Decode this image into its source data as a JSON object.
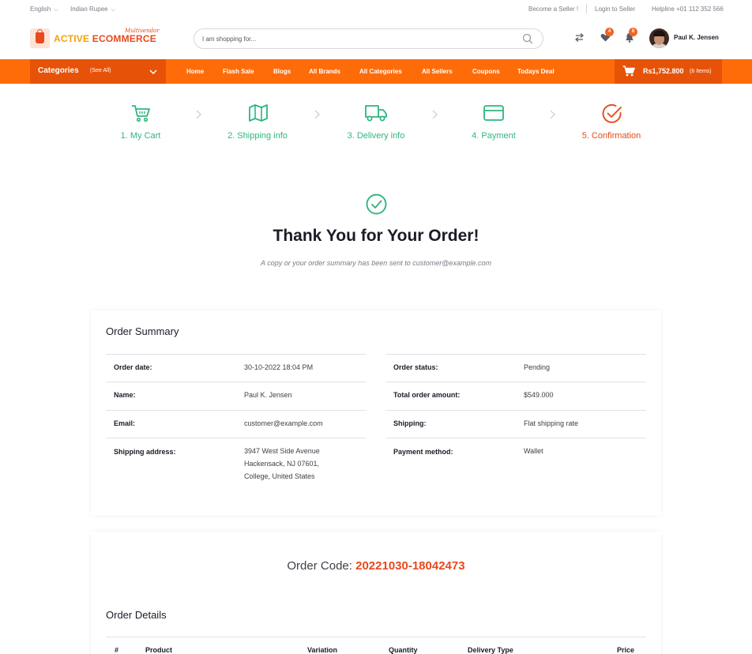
{
  "topbar": {
    "language": "English",
    "currency": "Indian Rupee",
    "become_seller": "Become a Seller !",
    "login_seller": "Login to Seller",
    "helpline": "Helpline +01 112 352 566"
  },
  "header": {
    "logo_word1": "ACTIVE",
    "logo_word2": "ECOMMERCE",
    "logo_tagline": "Multivendor",
    "search_placeholder": "I am shopping for...",
    "wishlist_count": "4",
    "notification_count": "8",
    "user_name": "Paul K. Jensen"
  },
  "nav": {
    "categories_label": "Categories",
    "see_all": "(See All)",
    "links": [
      "Home",
      "Flash Sale",
      "Blogs",
      "All Brands",
      "All Categories",
      "All Sellers",
      "Coupons",
      "Todays Deal"
    ],
    "cart_amount": "Rs1,752.800",
    "cart_items": "(6 Items)"
  },
  "steps": [
    {
      "label": "1. My Cart",
      "icon": "cart-icon"
    },
    {
      "label": "2. Shipping info",
      "icon": "map-icon"
    },
    {
      "label": "3. Delivery info",
      "icon": "truck-icon"
    },
    {
      "label": "4. Payment",
      "icon": "card-icon"
    },
    {
      "label": "5. Confirmation",
      "icon": "check-circle-icon"
    }
  ],
  "thankyou": {
    "title": "Thank You for Your Order!",
    "subtitle": "A copy or your order summary has been sent to customer@example.com"
  },
  "order_summary": {
    "title": "Order Summary",
    "left": [
      {
        "label": "Order date:",
        "value": "30-10-2022 18:04 PM"
      },
      {
        "label": "Name:",
        "value": "Paul K. Jensen"
      },
      {
        "label": "Email:",
        "value": "customer@example.com"
      },
      {
        "label": "Shipping address:",
        "value_lines": [
          "3947 West Side Avenue",
          "Hackensack, NJ 07601,",
          "College, United States"
        ]
      }
    ],
    "right": [
      {
        "label": "Order status:",
        "value": "Pending"
      },
      {
        "label": "Total order amount:",
        "value": "$549.000"
      },
      {
        "label": "Shipping:",
        "value": "Flat shipping rate"
      },
      {
        "label": "Payment method:",
        "value": "Wallet"
      }
    ]
  },
  "order_code": {
    "label": "Order Code:",
    "value": "20221030-18042473"
  },
  "order_details": {
    "title": "Order Details",
    "columns": [
      "#",
      "Product",
      "Variation",
      "Quantity",
      "Delivery Type",
      "Price"
    ]
  },
  "colors": {
    "brand_orange": "#fe6c0a",
    "brand_dark_orange": "#e65308",
    "accent_red": "#e8491d",
    "success_green": "#2eb67d"
  }
}
